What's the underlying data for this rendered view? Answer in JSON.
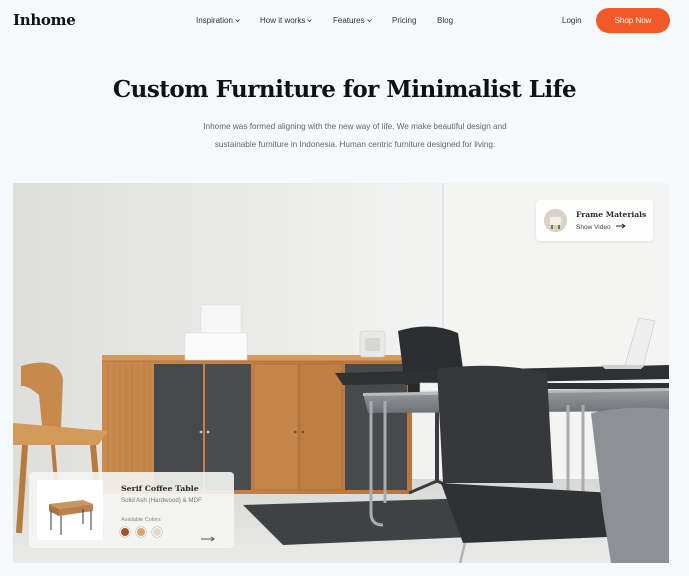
{
  "brand": {
    "logo": "Inhome"
  },
  "nav": {
    "items": [
      {
        "label": "Inspiration",
        "dropdown": true
      },
      {
        "label": "How it works",
        "dropdown": true
      },
      {
        "label": "Features",
        "dropdown": true
      },
      {
        "label": "Pricing",
        "dropdown": false
      },
      {
        "label": "Blog",
        "dropdown": false
      }
    ],
    "login_label": "Login",
    "cta_label": "Shop Now"
  },
  "hero": {
    "title": "Custom Furniture for Minimalist Life",
    "subtitle_line1": "Inhome was formed aligning with the new way of life. We make beautiful design and",
    "subtitle_line2": "sustainable furniture in Indonesia. Human centric furniture designed for living."
  },
  "frame_card": {
    "title": "Frame Materials",
    "link_label": "Show Video"
  },
  "product_card": {
    "name": "Serif Coffee Table",
    "material": "Solid Ash (Hardwood) & MDF",
    "colors_label": "Available Colors",
    "colors": [
      "#a3502c",
      "#d9a36a",
      "#ead9c2"
    ]
  },
  "colors": {
    "accent": "#f05a28",
    "background": "#f6f9fc"
  },
  "icons": {
    "dropdown": "chevron-down-icon",
    "arrow": "arrow-right-icon"
  }
}
